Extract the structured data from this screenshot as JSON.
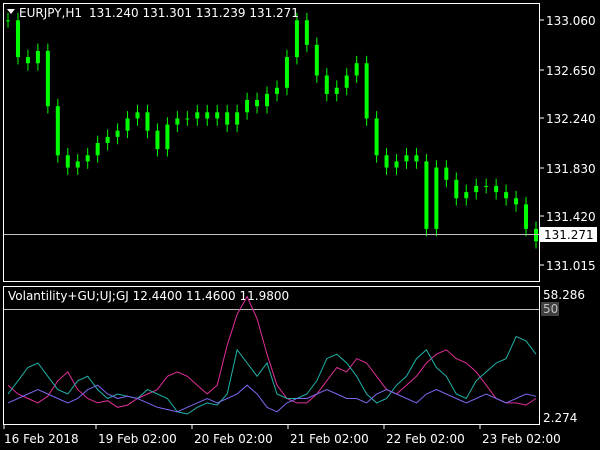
{
  "header": {
    "symbol": "EURJPY,H1",
    "ohlc": "131.240 131.301 131.239 131.271"
  },
  "indicator": {
    "label": "Volantility+GU;UJ;GJ 12.4400 11.4600 11.9800",
    "level_label": "50",
    "scale_top": "58.286",
    "scale_bottom": "2.274"
  },
  "price_axis": {
    "ticks": [
      "133.060",
      "132.650",
      "132.240",
      "131.830",
      "131.420",
      "131.015"
    ],
    "current_price": "131.271"
  },
  "time_axis": {
    "labels": [
      "16 Feb 2018",
      "19 Feb 02:00",
      "20 Feb 02:00",
      "21 Feb 02:00",
      "22 Feb 02:00",
      "23 Feb 02:00"
    ]
  },
  "colors": {
    "background": "#000000",
    "frame": "#ffffff",
    "candle": "#00ff00",
    "price_line": "#c0c0c0",
    "indicator_level": "#c0c0c0",
    "series_gu": "#e0309a",
    "series_uj": "#20b2aa",
    "series_gj": "#7b68ee"
  },
  "chart_data": [
    {
      "type": "line",
      "title": "EURJPY,H1",
      "ylim": [
        130.95,
        133.15
      ],
      "x": [
        0,
        10,
        20,
        30,
        40,
        50,
        60,
        70,
        80,
        90,
        100,
        110,
        120,
        130,
        140,
        150,
        160,
        170,
        180,
        190,
        200,
        210,
        220,
        230,
        240,
        250,
        260,
        270,
        280,
        290,
        300,
        310,
        320,
        330,
        340,
        350,
        360,
        370,
        380,
        390,
        400,
        410,
        420,
        430,
        440,
        450,
        460,
        470,
        480,
        490,
        500,
        510,
        520,
        530
      ],
      "values": [
        133.05,
        132.75,
        132.7,
        132.8,
        132.35,
        131.95,
        131.85,
        131.9,
        131.95,
        132.05,
        132.1,
        132.15,
        132.25,
        132.3,
        132.15,
        132.0,
        132.2,
        132.25,
        132.25,
        132.3,
        132.25,
        132.3,
        132.2,
        132.3,
        132.4,
        132.35,
        132.45,
        132.5,
        132.75,
        133.05,
        132.85,
        132.6,
        132.45,
        132.5,
        132.6,
        132.7,
        132.25,
        131.95,
        131.85,
        131.9,
        131.95,
        131.9,
        131.35,
        131.85,
        131.75,
        131.6,
        131.65,
        131.7,
        131.7,
        131.65,
        131.6,
        131.55,
        131.35,
        131.25
      ],
      "ylabel": ""
    },
    {
      "type": "line",
      "title": "Volantility+GU;UJ;GJ 12.4400 11.4600 11.9800",
      "ylim": [
        2.274,
        58.286
      ],
      "x": [
        0,
        10,
        20,
        30,
        40,
        50,
        60,
        70,
        80,
        90,
        100,
        110,
        120,
        130,
        140,
        150,
        160,
        170,
        180,
        190,
        200,
        210,
        220,
        230,
        240,
        250,
        260,
        270,
        280,
        290,
        300,
        310,
        320,
        330,
        340,
        350,
        360,
        370,
        380,
        390,
        400,
        410,
        420,
        430,
        440,
        450,
        460,
        470,
        480,
        490,
        500,
        510,
        520,
        530
      ],
      "series": [
        {
          "name": "GU",
          "values": [
            18,
            14,
            12,
            10,
            13,
            20,
            24,
            16,
            12,
            10,
            11,
            8,
            9,
            12,
            14,
            16,
            22,
            24,
            22,
            18,
            14,
            18,
            36,
            50,
            58,
            48,
            32,
            18,
            12,
            10,
            10,
            14,
            20,
            26,
            24,
            30,
            28,
            22,
            16,
            14,
            18,
            22,
            28,
            32,
            34,
            30,
            28,
            24,
            18,
            12,
            10,
            10,
            9,
            12
          ]
        },
        {
          "name": "UJ",
          "values": [
            14,
            20,
            26,
            28,
            22,
            16,
            14,
            20,
            22,
            16,
            12,
            14,
            13,
            12,
            16,
            14,
            12,
            6,
            5,
            8,
            10,
            9,
            14,
            34,
            28,
            22,
            28,
            14,
            12,
            12,
            14,
            20,
            30,
            32,
            28,
            22,
            14,
            10,
            12,
            18,
            22,
            30,
            34,
            26,
            22,
            14,
            12,
            20,
            24,
            28,
            30,
            40,
            38,
            32
          ]
        },
        {
          "name": "GJ",
          "values": [
            10,
            12,
            14,
            16,
            14,
            12,
            10,
            12,
            16,
            18,
            14,
            12,
            13,
            12,
            10,
            8,
            7,
            6,
            8,
            10,
            12,
            10,
            12,
            14,
            18,
            14,
            8,
            6,
            10,
            12,
            12,
            14,
            16,
            14,
            12,
            12,
            10,
            14,
            16,
            14,
            12,
            10,
            14,
            16,
            14,
            12,
            10,
            12,
            14,
            12,
            10,
            12,
            14,
            13
          ]
        }
      ],
      "ylabel": ""
    }
  ]
}
